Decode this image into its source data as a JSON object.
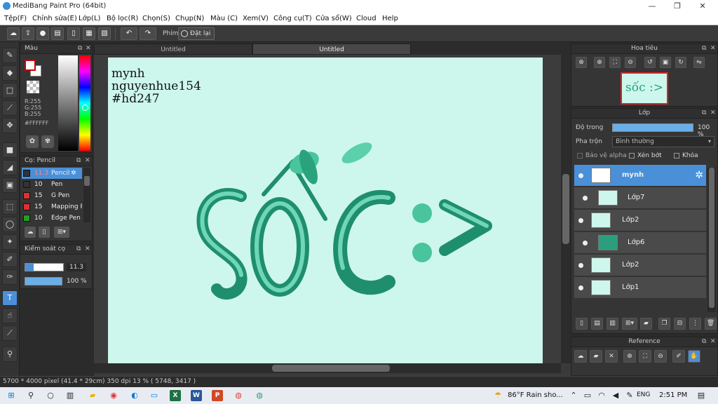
{
  "window": {
    "title": "MediBang Paint Pro (64bit)",
    "controls": {
      "minimize": "—",
      "maximize": "❐",
      "close": "✕"
    }
  },
  "menu": [
    "Tệp(F)",
    "Chỉnh sửa(E)",
    "Lớp(L)",
    "Bộ lọc(R)",
    "Chọn(S)",
    "Chụp(N)",
    "Màu (C)",
    "Xem(V)",
    "Công cụ(T)",
    "Cửa sổ(W)",
    "Cloud",
    "Help"
  ],
  "toolbar": {
    "phim_label": "Phím",
    "reset_label": "Đặt lại",
    "icons": [
      "cloud-icon",
      "export-icon",
      "speech-bubble-icon",
      "text-bubble-icon",
      "page-icon",
      "panel-icon",
      "panel-alt-icon",
      "undo-icon",
      "redo-icon"
    ]
  },
  "color_panel": {
    "title": "Màu",
    "r": "R:255",
    "g": "G:255",
    "b": "B:255",
    "hex": "#FFFFFF",
    "primary_color": "#ffffff",
    "secondary_color": "#ffffff"
  },
  "brush_panel": {
    "title": "Cọ: Pencil",
    "items": [
      {
        "size": "11.3",
        "name": "Pencil",
        "color": "#333333",
        "selected": true
      },
      {
        "size": "10",
        "name": "Pen",
        "color": "#333333"
      },
      {
        "size": "15",
        "name": "G Pen",
        "color": "#e03030"
      },
      {
        "size": "15",
        "name": "Mapping Pen",
        "color": "#e03030"
      },
      {
        "size": "10",
        "name": "Edge Pen",
        "color": "#20a020"
      }
    ]
  },
  "brush_control": {
    "title": "Kiểm soát cọ",
    "size_value": "11.3",
    "size_fraction": 0.22,
    "opacity_value": "100 %",
    "opacity_fraction": 1.0
  },
  "document": {
    "tabs": [
      "Untitled",
      "Untitled"
    ],
    "active_tab": 1,
    "canvas_text": [
      "mynh",
      "nguyenhue154",
      "#hd247"
    ],
    "art_text": "sốc :>",
    "canvas_bg": "#cdf7ec",
    "art_color": "#2a9e7d"
  },
  "navigator": {
    "title": "Hoa tiêu",
    "preview_text": "sốc :>"
  },
  "layer_panel": {
    "title": "Lớp",
    "opacity_label": "Độ trong",
    "opacity_value": "100 %",
    "blend_label": "Pha trộn",
    "blend_value": "Bình thường",
    "protect_alpha": "Bảo vệ alpha",
    "clipping": "Xén bớt",
    "lock": "Khóa",
    "layers": [
      {
        "name": "mynh",
        "selected": true
      },
      {
        "name": "Lớp7"
      },
      {
        "name": "Lớp2"
      },
      {
        "name": "Lớp6"
      },
      {
        "name": "Lớp2"
      },
      {
        "name": "Lớp1"
      }
    ]
  },
  "reference_panel": {
    "title": "Reference"
  },
  "status": {
    "text": "5700 * 4000 pixel   (41.4 * 29cm)   350 dpi   13 %   ( 5748, 3417 )"
  },
  "taskbar": {
    "weather": "86°F  Rain sho...",
    "language": "ENG",
    "time": "2:51 PM"
  }
}
